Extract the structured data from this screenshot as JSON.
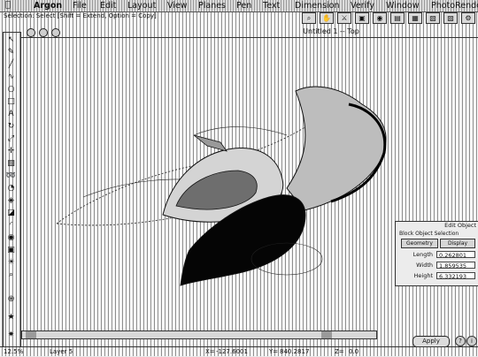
{
  "menubar": {
    "app": "Argon",
    "items": [
      "File",
      "Edit",
      "Layout",
      "View",
      "Planes",
      "Pen",
      "Text",
      "Dimension",
      "Verify",
      "Window",
      "PhotoRender"
    ]
  },
  "status": {
    "hint": "Selection: Select [Shift = Extend, Option = Copy]"
  },
  "window": {
    "title": "Untitled 1 -- Top"
  },
  "panel": {
    "title": "Edit Object",
    "subtitle": "Block Object Selection",
    "tabs": [
      "Geometry",
      "Display"
    ],
    "fields": [
      {
        "label": "Length",
        "value": "0.262801"
      },
      {
        "label": "Width",
        "value": "1.859535"
      },
      {
        "label": "Height",
        "value": "6.332193"
      }
    ],
    "apply_label": "Apply"
  },
  "bottombar": {
    "zoom": "12.5%",
    "layer": "Layer 5",
    "x_label": "X=",
    "x_value": "-127.6001",
    "y_label": "Y=",
    "y_value": "840.2817",
    "z_label": "Z=",
    "z_value": "0.0"
  },
  "icons": {
    "apple": "apple-icon",
    "tools": [
      "arrow",
      "pen",
      "line",
      "curve",
      "circle",
      "box",
      "text",
      "rotate",
      "scale",
      "move",
      "extrude",
      "sweep",
      "revolve",
      "loft",
      "shell",
      "fillet",
      "render",
      "camera",
      "light",
      "zoom"
    ]
  }
}
